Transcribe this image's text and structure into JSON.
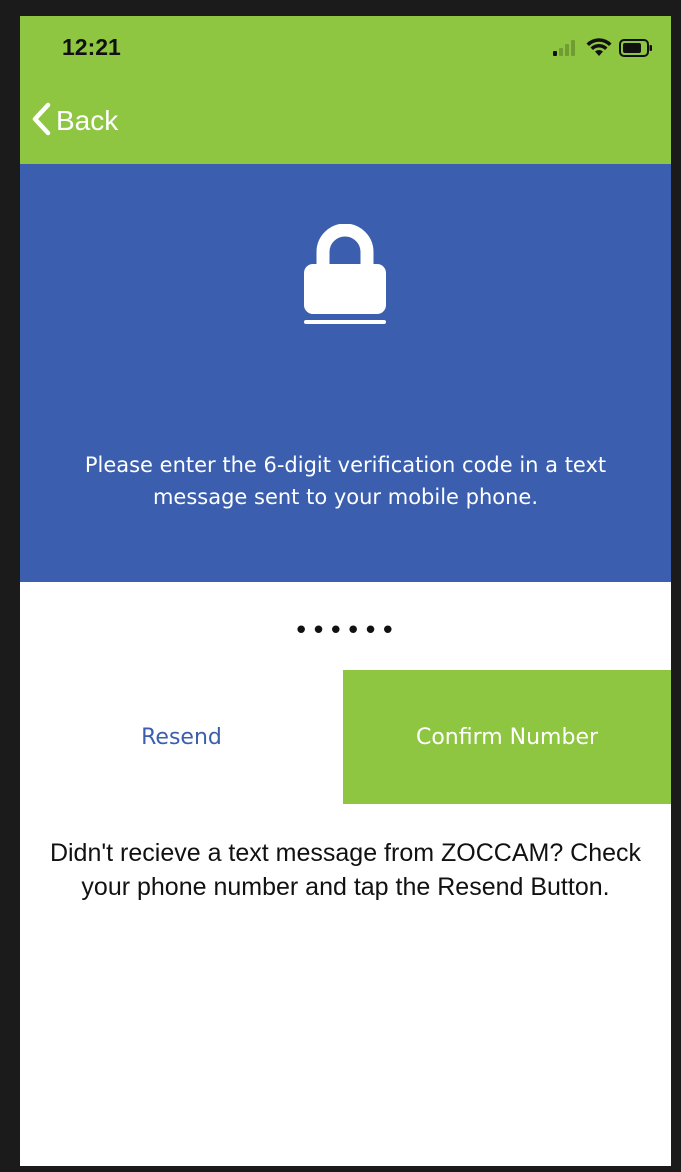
{
  "status_bar": {
    "time": "12:21",
    "icons": [
      "signal-icon",
      "wifi-icon",
      "battery-icon"
    ]
  },
  "nav": {
    "back_label": "Back",
    "back_icon": "chevron-left-icon"
  },
  "banner": {
    "icon": "lock-icon",
    "instruction": "Please enter the 6-digit verification code in a text message sent to your mobile phone."
  },
  "code_field": {
    "value": "••••••"
  },
  "actions": {
    "resend_label": "Resend",
    "confirm_label": "Confirm Number"
  },
  "help": {
    "text": "Didn't recieve a text message from ZOCCAM? Check your phone number and tap the Resend Button."
  },
  "colors": {
    "header_green": "#8fc641",
    "banner_blue": "#3b5fae",
    "confirm_green": "#8fc641",
    "resend_text_blue": "#3b5fae"
  }
}
